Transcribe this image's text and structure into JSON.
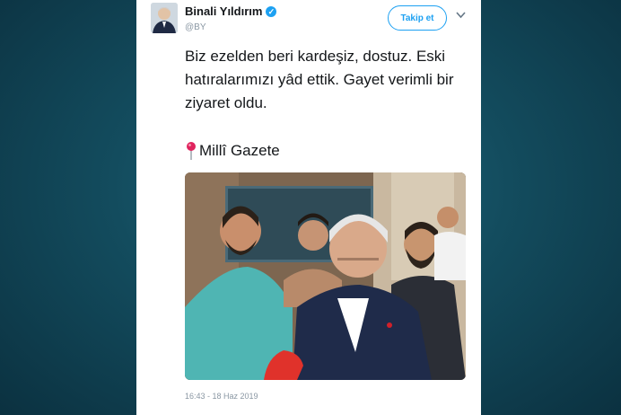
{
  "tweet": {
    "author_name": "Binali Yıldırım",
    "handle": "@BY",
    "follow_label": "Takip et",
    "text": "Biz ezelden beri kardeşiz, dostuz. Eski hatıralarımızı yâd ettik. Gayet verimli bir ziyaret oldu.",
    "source": "Millî Gazete",
    "timestamp": "16:43 - 18 Haz 2019"
  },
  "icons": {
    "verified": "verified-badge-icon",
    "pin": "round-pushpin-icon",
    "more": "chevron-down-icon"
  },
  "colors": {
    "accent": "#1da1f2",
    "background": "#134c5e",
    "card": "#ffffff"
  }
}
